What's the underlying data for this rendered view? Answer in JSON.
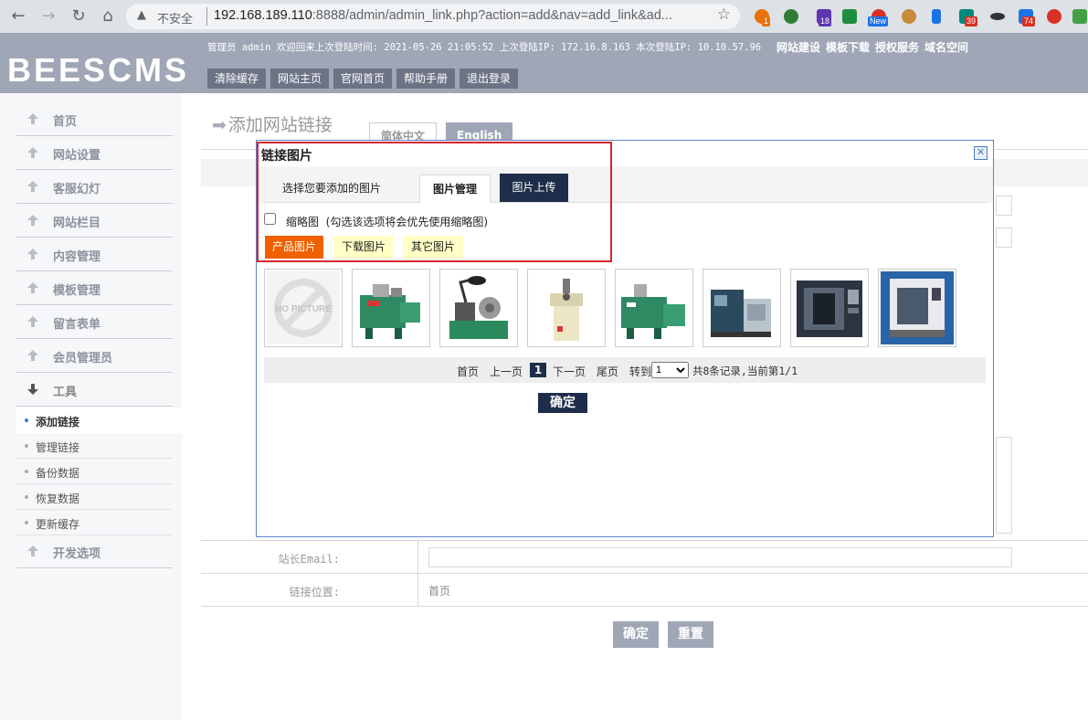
{
  "browser": {
    "insecure_label": "不安全",
    "url_host": "192.168.189.110",
    "url_rest": ":8888/admin/admin_link.php?action=add&nav=add_link&ad...",
    "badges": [
      "1",
      "18",
      "New",
      "39",
      "74"
    ]
  },
  "header": {
    "logo": "BEESCMS",
    "info": "管理员 admin 欢迎回来上次登陆时间: 2021-05-26 21:05:52 上次登陆IP: 172.16.8.163 本次登陆IP: 10.10.57.96",
    "links": [
      "网站建设",
      "模板下载",
      "授权服务",
      "域名空间"
    ],
    "buttons": [
      "清除缓存",
      "网站主页",
      "官网首页",
      "帮助手册",
      "退出登录"
    ]
  },
  "sidebar": {
    "nav": [
      "首页",
      "网站设置",
      "客服幻灯",
      "网站栏目",
      "内容管理",
      "模板管理",
      "留言表单",
      "会员管理员"
    ],
    "tools": "工具",
    "sub": [
      "添加链接",
      "管理链接",
      "备份数据",
      "恢复数据",
      "更新缓存"
    ],
    "dev": "开发选项"
  },
  "page": {
    "title": "添加网站链接",
    "lang_tabs": [
      "简体中文",
      "English"
    ],
    "email_label": "站长Email:",
    "position_label": "链接位置:",
    "position_value": "首页",
    "submit": "确定",
    "reset": "重置"
  },
  "dialog": {
    "title": "链接图片",
    "hint": "选择您要添加的图片",
    "tabs": [
      "图片管理",
      "图片上传"
    ],
    "thumb_label": "缩略图",
    "thumb_note": "(勾选该选项将会优先使用缩略图)",
    "thumb_checked": false,
    "categories": [
      "产品图片",
      "下载图片",
      "其它图片"
    ],
    "active_category": "产品图片",
    "no_picture": "NO PICTURE",
    "pager": {
      "first": "首页",
      "prev": "上一页",
      "current": "1",
      "next": "下一页",
      "last": "尾页",
      "goto": "转到",
      "select_value": "1",
      "summary": "共8条记录,当前第1/1"
    },
    "ok": "确定"
  },
  "colors": {
    "header_bg": "#9fa6b6",
    "active_category": "#f06000",
    "category_bg": "#ffffc6",
    "tab_dark": "#1e2d4a",
    "highlight_border": "#d9252b"
  }
}
